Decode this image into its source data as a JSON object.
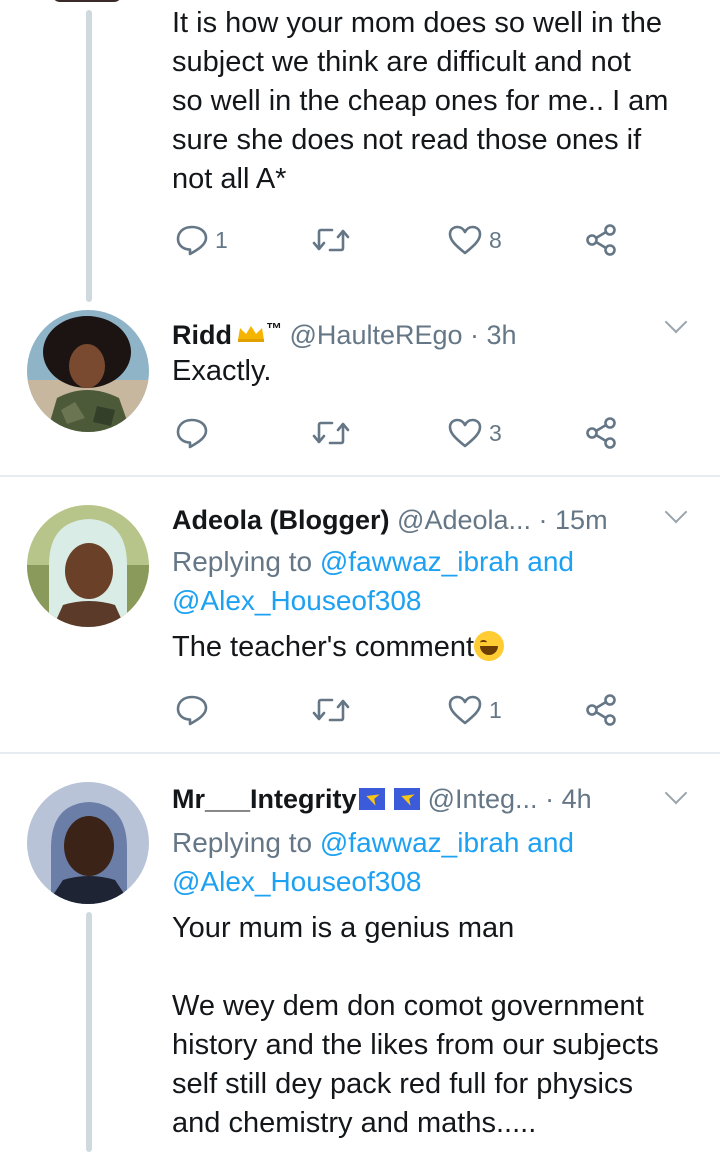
{
  "tweets": [
    {
      "text": [
        "It is how your mom does so well in the",
        "subject we think are difficult and not",
        "so well in the cheap ones for me.. I am",
        "sure she does not read those ones if",
        "not all A*"
      ],
      "reply_count": "1",
      "like_count": "8"
    },
    {
      "name": "Ridd",
      "badge": "™",
      "handle": "@HaulteREgo",
      "time": "· 3h",
      "text": "Exactly.",
      "like_count": "3"
    },
    {
      "name": "Adeola (Blogger)",
      "handle": "@Adeola...",
      "time": "· 15m",
      "reply_prefix": "Replying to",
      "reply_user1": "@fawwaz_ibrah",
      "reply_and": "and",
      "reply_user2": "@Alex_Houseof308",
      "text": "The teacher's comment",
      "like_count": "1"
    },
    {
      "name": "Mr___Integrity",
      "handle": "@Integ...",
      "time": "· 4h",
      "reply_prefix": "Replying to",
      "reply_user1": "@fawwaz_ibrah",
      "reply_and": "and",
      "reply_user2": "@Alex_Houseof308",
      "text": [
        "Your mum is a genius man",
        "We wey dem don comot government",
        "history and the likes from our subjects",
        "self still dey pack red full for physics",
        "and chemistry and maths....."
      ]
    }
  ],
  "colors": {
    "link": "#1da1f2",
    "meta": "#657786",
    "thread": "#cfd9de"
  }
}
